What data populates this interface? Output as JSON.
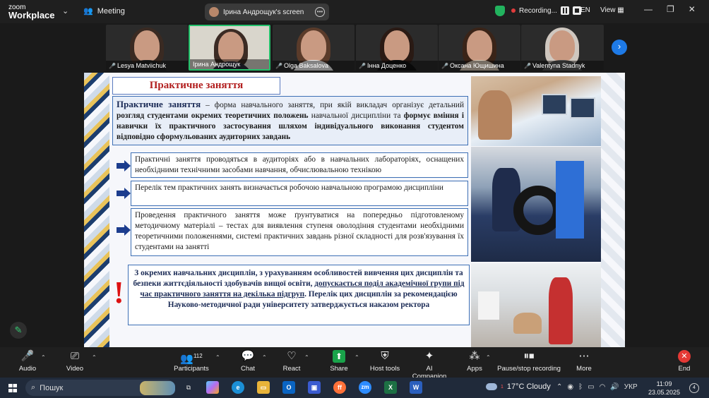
{
  "topbar": {
    "logo_zoom": "zoom",
    "logo_workplace": "Workplace",
    "meeting_label": "Meeting",
    "screen_share_label": "Ірина  Андрощук's screen",
    "recording_label": "Recording...",
    "language": "EN",
    "view_label": "View"
  },
  "participants": [
    {
      "name": "Lesya Matviichuk"
    },
    {
      "name": "Ірина  Андрощук"
    },
    {
      "name": "Olga Baksalova"
    },
    {
      "name": "Інна Доценко"
    },
    {
      "name": "Оксана Ющишина"
    },
    {
      "name": "Valentyna Stadnyk"
    }
  ],
  "slide": {
    "title": "Практичне заняття",
    "definition_term": "Практичне заняття",
    "definition_p1": " – форма навчального заняття, при якій викладач організує детальний ",
    "definition_b1": "розгляд студентами окремих теоретичних положень",
    "definition_p2": " навчальної дисципліни та ",
    "definition_b2": "формує вміння і навички їх практичного застосування шляхом індивідуального виконання студентом відповідно сформульованих аудиторних завдань",
    "point1": "Практичні заняття проводяться в аудиторіях або в навчальних лабораторіях, оснащених необхідними технічними засобами навчання, обчислювальною технікою",
    "point2": "Перелік тем практичних занять визначається робочою навчальною програмою дисципліни",
    "point3": "Проведення практичного заняття може ґрунтуватися на попередньо підготовленому методичному матеріалі – тестах для виявлення ступеня оволодіння студентами необхідними теоретичними положеннями, системі практичних завдань різної складності для розв'язування їх студентами на занятті",
    "note_p1": "З окремих навчальних дисциплін, з урахуванням особливостей вивчення цих дисциплін та безпеки життєдіяльності здобувачів вищої освіти, ",
    "note_u": "допускається поділ академічної групи під час практичного заняття на декілька підгруп",
    "note_p2": ". Перелік цих дисциплін за рекомендацією Науково-методичної ради університету затверджується наказом ректора",
    "excl": "!"
  },
  "toolbar": {
    "audio": "Audio",
    "video": "Video",
    "participants": "Participants",
    "participants_count": "112",
    "chat": "Chat",
    "react": "React",
    "share": "Share",
    "host_tools": "Host tools",
    "ai_companion": "AI Companion",
    "apps": "Apps",
    "pause_recording": "Pause/stop recording",
    "more": "More",
    "end": "End"
  },
  "taskbar": {
    "search_placeholder": "Пошук",
    "weather": "17°C  Cloudy",
    "weather_badge": "1",
    "lang": "УКР",
    "time": "11:09",
    "date": "23.05.2025",
    "notif_count": "4"
  },
  "icons": {
    "shield": "shield-check-icon",
    "mic": "mic-off-icon",
    "camera": "camera-off-icon"
  },
  "colors": {
    "slide_title_red": "#b21e1e",
    "slide_border_blue": "#3d6fb5",
    "active_speaker_green": "#24c16b",
    "end_red": "#e53935",
    "share_green": "#19a34a"
  }
}
